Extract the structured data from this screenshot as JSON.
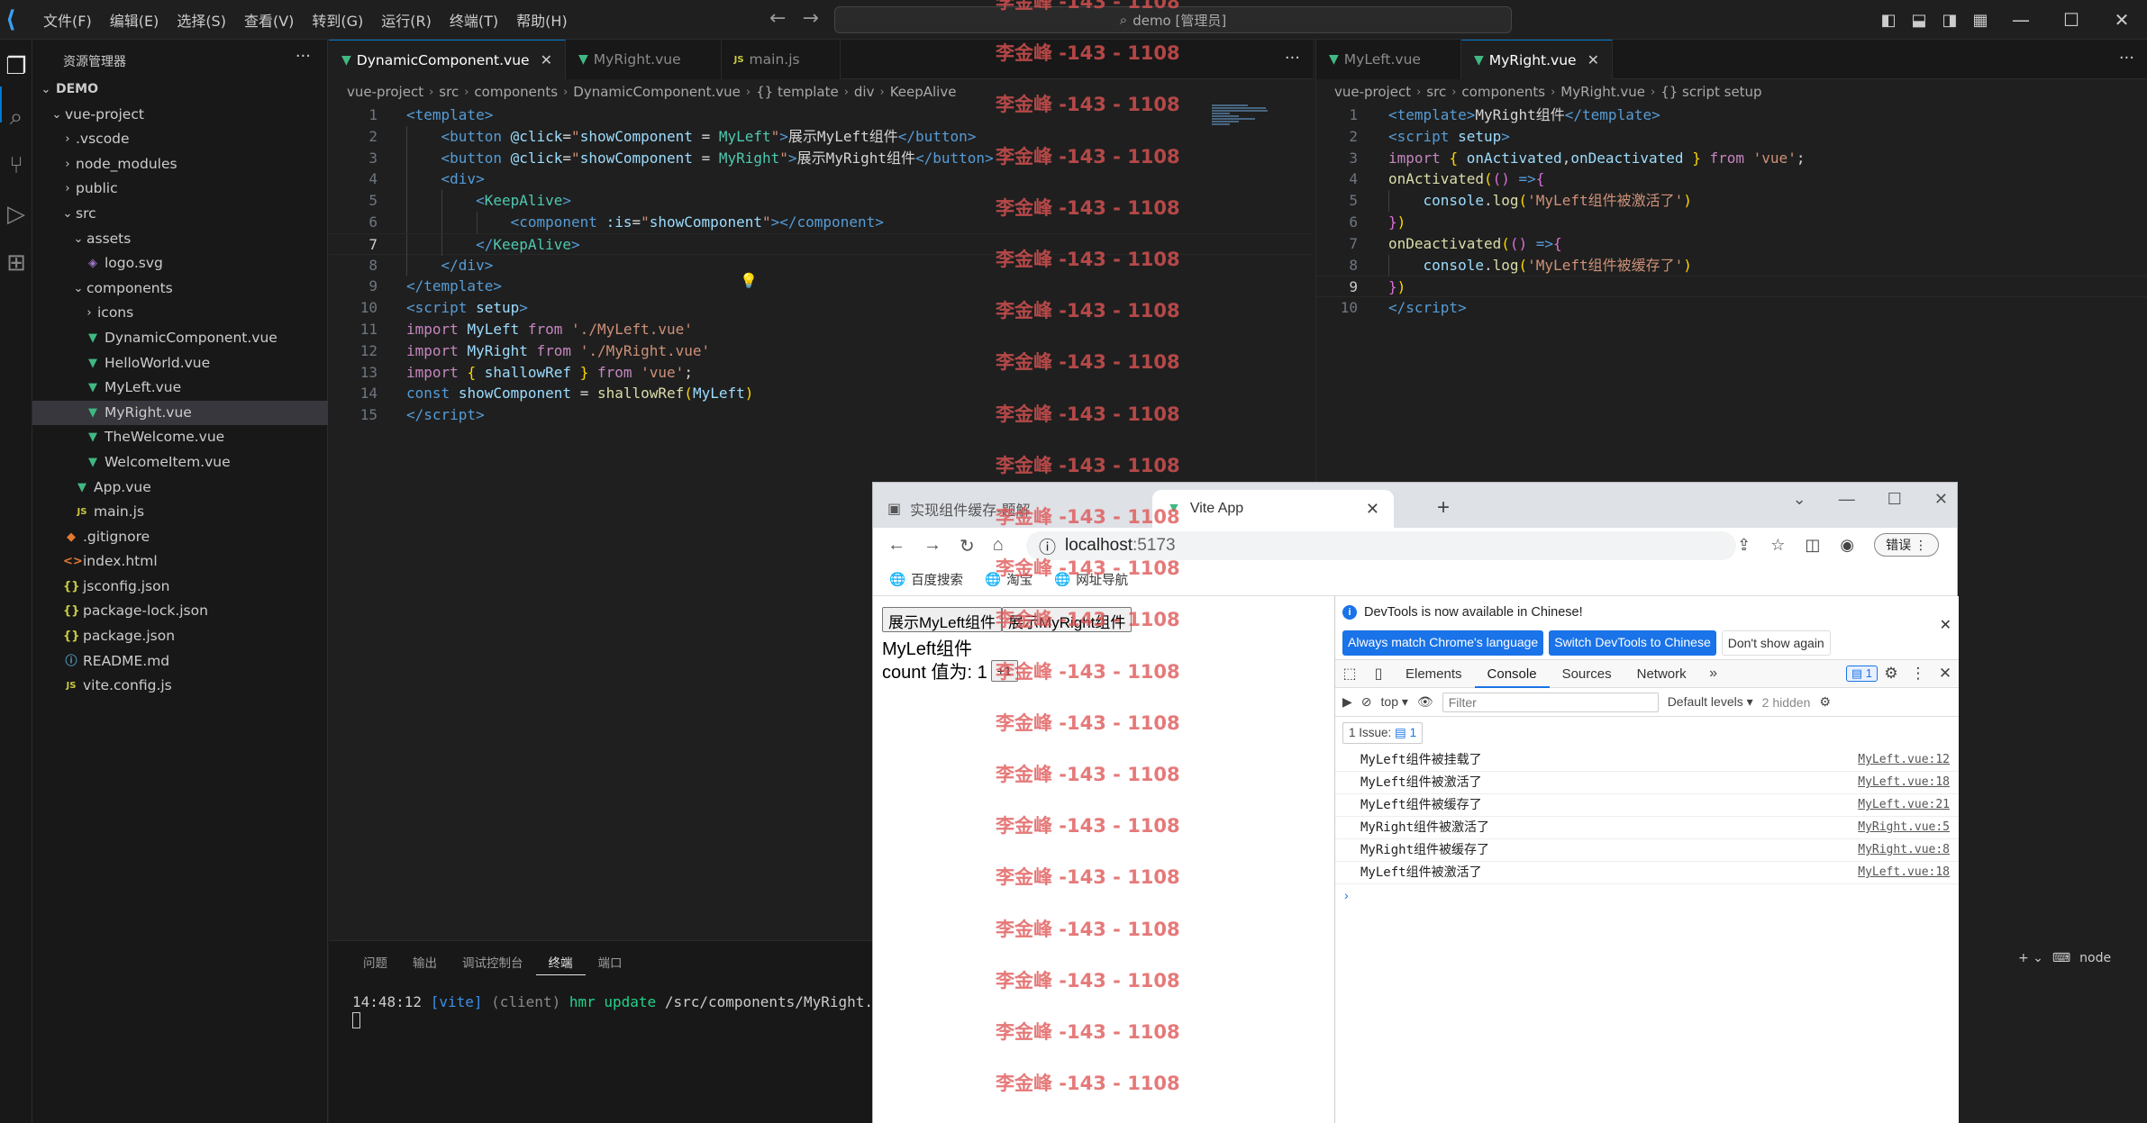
{
  "menu": [
    "文件(F)",
    "编辑(E)",
    "选择(S)",
    "查看(V)",
    "转到(G)",
    "运行(R)",
    "终端(T)",
    "帮助(H)"
  ],
  "command_center": "demo [管理员]",
  "explorer": {
    "title": "资源管理器",
    "root": "DEMO",
    "items": [
      {
        "label": "vue-project",
        "depth": 1,
        "chev": "v",
        "icon": ""
      },
      {
        "label": ".vscode",
        "depth": 2,
        "chev": ">",
        "icon": ""
      },
      {
        "label": "node_modules",
        "depth": 2,
        "chev": ">",
        "icon": ""
      },
      {
        "label": "public",
        "depth": 2,
        "chev": ">",
        "icon": ""
      },
      {
        "label": "src",
        "depth": 2,
        "chev": "v",
        "icon": ""
      },
      {
        "label": "assets",
        "depth": 3,
        "chev": "v",
        "icon": ""
      },
      {
        "label": "logo.svg",
        "depth": 4,
        "chev": "",
        "icon": "svg"
      },
      {
        "label": "components",
        "depth": 3,
        "chev": "v",
        "icon": ""
      },
      {
        "label": "icons",
        "depth": 4,
        "chev": ">",
        "icon": ""
      },
      {
        "label": "DynamicComponent.vue",
        "depth": 4,
        "chev": "",
        "icon": "vue"
      },
      {
        "label": "HelloWorld.vue",
        "depth": 4,
        "chev": "",
        "icon": "vue"
      },
      {
        "label": "MyLeft.vue",
        "depth": 4,
        "chev": "",
        "icon": "vue"
      },
      {
        "label": "MyRight.vue",
        "depth": 4,
        "chev": "",
        "icon": "vue",
        "selected": true
      },
      {
        "label": "TheWelcome.vue",
        "depth": 4,
        "chev": "",
        "icon": "vue"
      },
      {
        "label": "WelcomeItem.vue",
        "depth": 4,
        "chev": "",
        "icon": "vue"
      },
      {
        "label": "App.vue",
        "depth": 3,
        "chev": "",
        "icon": "vue"
      },
      {
        "label": "main.js",
        "depth": 3,
        "chev": "",
        "icon": "js"
      },
      {
        "label": ".gitignore",
        "depth": 2,
        "chev": "",
        "icon": "git"
      },
      {
        "label": "index.html",
        "depth": 2,
        "chev": "",
        "icon": "html"
      },
      {
        "label": "jsconfig.json",
        "depth": 2,
        "chev": "",
        "icon": "json"
      },
      {
        "label": "package-lock.json",
        "depth": 2,
        "chev": "",
        "icon": "json"
      },
      {
        "label": "package.json",
        "depth": 2,
        "chev": "",
        "icon": "json"
      },
      {
        "label": "README.md",
        "depth": 2,
        "chev": "",
        "icon": "md"
      },
      {
        "label": "vite.config.js",
        "depth": 2,
        "chev": "",
        "icon": "js"
      }
    ]
  },
  "editor1": {
    "tabs": [
      {
        "label": "DynamicComponent.vue",
        "icon": "vue",
        "active": true,
        "close": "✕"
      },
      {
        "label": "MyRight.vue",
        "icon": "vue",
        "active": false,
        "close": ""
      },
      {
        "label": "main.js",
        "icon": "js",
        "active": false,
        "close": ""
      }
    ],
    "breadcrumb": [
      "vue-project",
      "src",
      "components",
      "DynamicComponent.vue",
      "{} template",
      "div",
      "KeepAlive"
    ]
  },
  "editor2": {
    "tabs": [
      {
        "label": "MyLeft.vue",
        "icon": "vue",
        "active": false,
        "close": ""
      },
      {
        "label": "MyRight.vue",
        "icon": "vue",
        "active": true,
        "close": "✕"
      }
    ],
    "breadcrumb": [
      "vue-project",
      "src",
      "components",
      "MyRight.vue",
      "{} script setup"
    ]
  },
  "panel": {
    "tabs": [
      "问题",
      "输出",
      "调试控制台",
      "终端",
      "端口"
    ],
    "active_tab": "终端",
    "terminal": {
      "time": "14:48:12",
      "tag": "[vite]",
      "client": "(client)",
      "hmr": "hmr update",
      "path": "/src/components/MyRight.vue"
    },
    "right": {
      "shell": "node"
    }
  },
  "browser": {
    "tabs": [
      {
        "label": "实现组件缓存-题解"
      },
      {
        "label": "Vite App"
      }
    ],
    "url_host": "localhost",
    "url_port": ":5173",
    "error_button": "错误",
    "bookmarks": [
      "百度搜索",
      "淘宝",
      "网址导航"
    ],
    "page": {
      "btn_left": "展示MyLeft组件",
      "btn_right": "展示MyRight组件",
      "component_title": "MyLeft组件",
      "count_label": "count 值为: 1",
      "inc_button": "+1"
    },
    "devtools": {
      "info": "DevTools is now available in Chinese!",
      "btn_match": "Always match Chrome's language",
      "btn_switch": "Switch DevTools to Chinese",
      "btn_dont": "Don't show again",
      "tabs": [
        "Elements",
        "Console",
        "Sources",
        "Network"
      ],
      "active_tab": "Console",
      "issues_badge": "1",
      "context": "top",
      "filter_placeholder": "Filter",
      "levels": "Default levels",
      "hidden": "2 hidden",
      "issue_label": "1 Issue:",
      "issue_count": "1",
      "logs": [
        {
          "msg": "MyLeft组件被挂载了",
          "src": "MyLeft.vue:12"
        },
        {
          "msg": "MyLeft组件被激活了",
          "src": "MyLeft.vue:18"
        },
        {
          "msg": "MyLeft组件被缓存了",
          "src": "MyLeft.vue:21"
        },
        {
          "msg": "MyRight组件被激活了",
          "src": "MyRight.vue:5"
        },
        {
          "msg": "MyRight组件被缓存了",
          "src": "MyRight.vue:8"
        },
        {
          "msg": "MyLeft组件被激活了",
          "src": "MyLeft.vue:18"
        }
      ]
    }
  },
  "watermark": "李金峰 -143 - 1108"
}
